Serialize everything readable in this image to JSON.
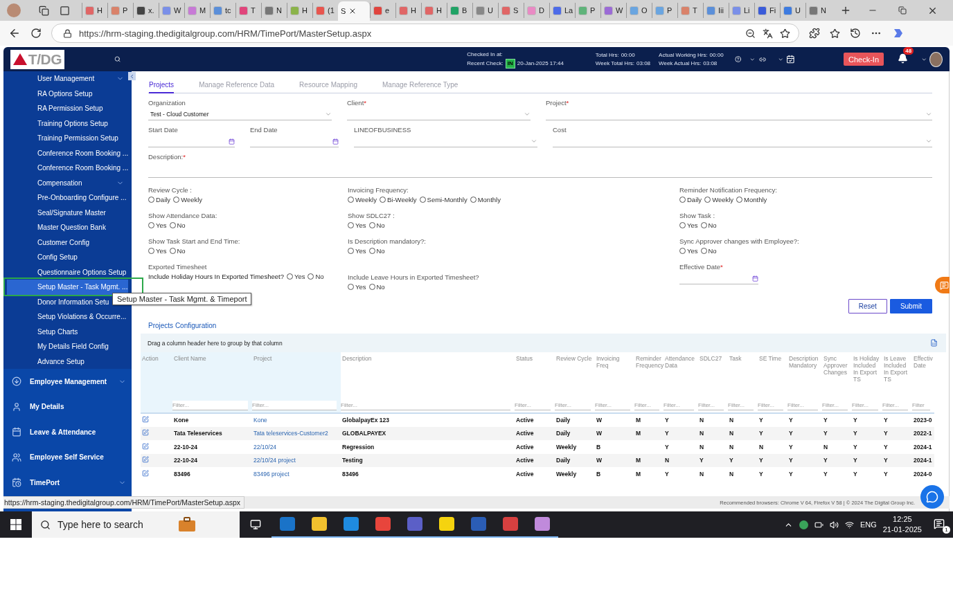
{
  "browser": {
    "tabs": [
      {
        "title": "H",
        "color": "#e06666",
        "selected": false
      },
      {
        "title": "P",
        "color": "#d9826a",
        "selected": false
      },
      {
        "title": "x.",
        "color": "#444444",
        "selected": false
      },
      {
        "title": "W",
        "color": "#7a8fe8",
        "selected": false
      },
      {
        "title": "M",
        "color": "#c77ad6",
        "selected": false
      },
      {
        "title": "tc",
        "color": "#5b8fd9",
        "selected": false
      },
      {
        "title": "T",
        "color": "#e0457b",
        "selected": false
      },
      {
        "title": "N",
        "color": "#777777",
        "selected": false
      },
      {
        "title": "H",
        "color": "#8bb34a",
        "selected": false
      },
      {
        "title": "(1",
        "color": "#e8554e",
        "selected": false
      },
      {
        "title": "S",
        "selected": true
      },
      {
        "title": "e",
        "color": "#e0443e",
        "selected": false
      },
      {
        "title": "H",
        "color": "#e06666",
        "selected": false
      },
      {
        "title": "H",
        "color": "#e06666",
        "selected": false
      },
      {
        "title": "B",
        "color": "#21a366",
        "selected": false
      },
      {
        "title": "U",
        "color": "#888888",
        "selected": false
      },
      {
        "title": "S",
        "color": "#e06666",
        "selected": false
      },
      {
        "title": "D",
        "color": "#e98ac4",
        "selected": false
      },
      {
        "title": "La",
        "color": "#4d6be8",
        "selected": false
      },
      {
        "title": "P",
        "color": "#5fb37a",
        "selected": false
      },
      {
        "title": "W",
        "color": "#9b6bd6",
        "selected": false
      },
      {
        "title": "O",
        "color": "#6aa5e0",
        "selected": false
      },
      {
        "title": "P",
        "color": "#6aa5e0",
        "selected": false
      },
      {
        "title": "T",
        "color": "#d9826a",
        "selected": false
      },
      {
        "title": "Iii",
        "color": "#5b8fd9",
        "selected": false
      },
      {
        "title": "Li",
        "color": "#7a8fe8",
        "selected": false
      },
      {
        "title": "Fi",
        "color": "#3a5bd9",
        "selected": false
      },
      {
        "title": "U",
        "color": "#3d7be0",
        "selected": false
      },
      {
        "title": "N",
        "color": "#777777",
        "selected": false
      }
    ],
    "url": "https://hrm-staging.thedigitalgroup.com/HRM/TimePort/MasterSetup.aspx"
  },
  "header": {
    "logo": "T/DG",
    "checked_in_label": "Checked In at:",
    "recent_check_label": "Recent Check:",
    "status_badge": "IN",
    "recent_check_time": "20-Jan-2025 17:44",
    "stats": [
      {
        "label": "Total Hrs:",
        "value": "00:00"
      },
      {
        "label": "Week Total Hrs:",
        "value": "03:08"
      },
      {
        "label": "Actual Working Hrs:",
        "value": "00:00"
      },
      {
        "label": "Week Actual Hrs:",
        "value": "03:08"
      }
    ],
    "check_in_button": "Check-In",
    "notification_count": "48"
  },
  "sidebar": {
    "sub_items": [
      {
        "label": "User Management",
        "expandable": true,
        "selected": false
      },
      {
        "label": "RA Options Setup",
        "selected": false
      },
      {
        "label": "RA Permission Setup",
        "selected": false
      },
      {
        "label": "Training Options Setup",
        "selected": false
      },
      {
        "label": "Training Permission Setup",
        "selected": false
      },
      {
        "label": "Conference Room Booking ...",
        "selected": false
      },
      {
        "label": "Conference Room Booking ...",
        "selected": false
      },
      {
        "label": "Compensation",
        "expandable": true,
        "selected": false
      },
      {
        "label": "Pre-Onboarding Configure ...",
        "selected": false
      },
      {
        "label": "Seal/Signature Master",
        "selected": false
      },
      {
        "label": "Master Question Bank",
        "selected": false
      },
      {
        "label": "Customer Config",
        "selected": false
      },
      {
        "label": "Config Setup",
        "selected": false
      },
      {
        "label": "Questionnaire Options Setup",
        "selected": false
      },
      {
        "label": "Setup Master - Task Mgmt. ...",
        "selected": true
      },
      {
        "label": "Donor Information Setu",
        "selected": false
      },
      {
        "label": "Setup Violations & Occurre...",
        "selected": false
      },
      {
        "label": "Setup Charts",
        "selected": false
      },
      {
        "label": "My Details Field Config",
        "selected": false
      },
      {
        "label": "Advance Setup",
        "selected": false
      }
    ],
    "tooltip": "Setup Master - Task Mgmt. & Timeport",
    "sections": [
      {
        "label": "Employee Management",
        "kind": "download",
        "expandable": true
      },
      {
        "label": "My Details",
        "kind": "person",
        "expandable": false
      },
      {
        "label": "Leave & Attendance",
        "kind": "calendar",
        "expandable": false
      },
      {
        "label": "Employee Self Service",
        "kind": "people",
        "expandable": false
      },
      {
        "label": "TimePort",
        "kind": "calendar-clock",
        "expandable": true
      }
    ]
  },
  "tabs": [
    {
      "label": "Projects",
      "selected": true
    },
    {
      "label": "Manage Reference Data",
      "selected": false
    },
    {
      "label": "Resource Mapping",
      "selected": false
    },
    {
      "label": "Manage Reference Type",
      "selected": false
    }
  ],
  "field_rows": [
    [
      {
        "label": "Organization",
        "kind": "select",
        "value": "Test - Cloud Customer"
      },
      {
        "label": "Client",
        "required_mark": "*",
        "kind": "select"
      },
      {
        "label": "Project",
        "required_mark": "*",
        "kind": "select"
      }
    ],
    [
      {
        "label": "Start Date",
        "kind": "date"
      },
      {
        "label": "End Date",
        "kind": "date"
      },
      {
        "label": "LINEOFBUSINESS",
        "kind": "select"
      },
      {
        "label": "Cost",
        "kind": "select"
      }
    ],
    [
      {
        "label": "Description:",
        "required_mark": "*",
        "kind": "text"
      }
    ]
  ],
  "option_rows": [
    [
      {
        "kind": "radio",
        "label": "Review Cycle :",
        "options": [
          {
            "label": "Daily",
            "checked": false
          },
          {
            "label": "Weekly",
            "checked": false
          }
        ]
      },
      {
        "kind": "radio",
        "label": "Invoicing Frequency:",
        "options": [
          {
            "label": "Weekly",
            "checked": false
          },
          {
            "label": "Bi-Weekly",
            "checked": false
          },
          {
            "label": "Semi-Monthly",
            "checked": false
          },
          {
            "label": "Monthly",
            "checked": false
          }
        ]
      },
      {
        "kind": "radio",
        "label": "Reminder Notification Frequency:",
        "options": [
          {
            "label": "Daily",
            "checked": false
          },
          {
            "label": "Weekly",
            "checked": false
          },
          {
            "label": "Monthly",
            "checked": false
          }
        ]
      }
    ],
    [
      {
        "kind": "radio",
        "label": "Show Attendance Data:",
        "options": [
          {
            "label": "Yes",
            "checked": false
          },
          {
            "label": "No",
            "checked": false
          }
        ]
      },
      {
        "kind": "radio",
        "label": "Show SDLC27 :",
        "options": [
          {
            "label": "Yes",
            "checked": false
          },
          {
            "label": "No",
            "checked": false
          }
        ]
      },
      {
        "kind": "radio",
        "label": "Show Task :",
        "options": [
          {
            "label": "Yes",
            "checked": false
          },
          {
            "label": "No",
            "checked": false
          }
        ]
      }
    ],
    [
      {
        "kind": "radio",
        "label": "Show Task Start and End Time:",
        "options": [
          {
            "label": "Yes",
            "checked": false
          },
          {
            "label": "No",
            "checked": false
          }
        ]
      },
      {
        "kind": "radio",
        "label": "Is Description mandatory?:",
        "options": [
          {
            "label": "Yes",
            "checked": false
          },
          {
            "label": "No",
            "checked": false
          }
        ]
      },
      {
        "kind": "radio",
        "label": "Sync Approver changes with Employee?:",
        "options": [
          {
            "label": "Yes",
            "checked": false
          },
          {
            "label": "No",
            "checked": false
          }
        ]
      }
    ],
    [
      {
        "kind": "inline_radio",
        "heading": "Exported Timesheet",
        "label": "Include Holiday Hours In Exported Timesheet?",
        "options": [
          {
            "label": "Yes",
            "checked": false
          },
          {
            "label": "No",
            "checked": false
          }
        ]
      },
      {
        "kind": "radio",
        "label": "Include Leave Hours in Exported Timesheet?",
        "options": [
          {
            "label": "Yes",
            "checked": false
          },
          {
            "label": "No",
            "checked": false
          }
        ]
      },
      {
        "kind": "date",
        "label": "Effective Date",
        "required_mark": "*"
      }
    ]
  ],
  "buttons": [
    {
      "label": "Reset",
      "kind": "secondary"
    },
    {
      "label": "Submit",
      "kind": "primary"
    }
  ],
  "grid": {
    "title": "Projects Configuration",
    "group_hint": "Drag a column header here to group by that column",
    "columns": [
      {
        "header": "Action",
        "kind": "action",
        "frozen": true
      },
      {
        "header": "Client Name",
        "placeholder": "Filter...",
        "kind": "text",
        "frozen": true
      },
      {
        "header": "Project",
        "placeholder": "Filter...",
        "kind": "link",
        "frozen": true
      },
      {
        "header": "Description",
        "placeholder": "Filter...",
        "kind": "text",
        "frozen": false
      },
      {
        "header": "Status",
        "placeholder": "Filter...",
        "kind": "text",
        "frozen": false
      },
      {
        "header": "Review Cycle",
        "placeholder": "Filter...",
        "kind": "text",
        "frozen": false
      },
      {
        "header": "Invoicing Freq",
        "placeholder": "Filter...",
        "kind": "text",
        "frozen": false
      },
      {
        "header": "Reminder Frequency",
        "placeholder": "Filter...",
        "kind": "text",
        "frozen": false
      },
      {
        "header": "Attendance Data",
        "placeholder": "Filter...",
        "kind": "text",
        "frozen": false
      },
      {
        "header": "SDLC27",
        "placeholder": "Filter...",
        "kind": "text",
        "frozen": false
      },
      {
        "header": "Task",
        "placeholder": "Filter...",
        "kind": "text",
        "frozen": false
      },
      {
        "header": "SE Time",
        "placeholder": "Filter...",
        "kind": "text",
        "frozen": false
      },
      {
        "header": "Description Mandatory",
        "placeholder": "Filter...",
        "kind": "text",
        "frozen": false
      },
      {
        "header": "Sync Approver Changes",
        "placeholder": "Filter...",
        "kind": "text",
        "frozen": false
      },
      {
        "header": "Is Holiday Included In Export TS",
        "placeholder": "Filter...",
        "kind": "text",
        "frozen": false
      },
      {
        "header": "Is Leave Included In Export TS",
        "placeholder": "Filter...",
        "kind": "text",
        "frozen": false
      },
      {
        "header": "Effectiv Date",
        "placeholder": "Filter",
        "kind": "text",
        "frozen": false
      }
    ],
    "rows": [
      [
        null,
        "Kone",
        "Kone",
        "GlobalpayEx 123",
        "Active",
        "Daily",
        "W",
        "M",
        "Y",
        "N",
        "N",
        "Y",
        "Y",
        "Y",
        "Y",
        "Y",
        "2023-0"
      ],
      [
        null,
        "Tata Teleservices",
        "Tata teleservices-Customer2",
        "GLOBALPAYEX",
        "Active",
        "Daily",
        "W",
        "M",
        "Y",
        "N",
        "N",
        "Y",
        "Y",
        "Y",
        "Y",
        "Y",
        "2022-1"
      ],
      [
        null,
        "22-10-24",
        "22/10/24",
        "Regression",
        "Active",
        "Weekly",
        "B",
        null,
        "Y",
        "N",
        "N",
        "N",
        "Y",
        "N",
        "Y",
        "Y",
        "2024-1"
      ],
      [
        null,
        "22-10-24",
        "22/10/24 project",
        "Testing",
        "Active",
        "Daily",
        "W",
        "M",
        "N",
        "Y",
        "Y",
        "Y",
        "Y",
        "Y",
        "Y",
        "Y",
        "2024-1"
      ],
      [
        null,
        "83496",
        "83496 project",
        "83496",
        "Active",
        "Weekly",
        "B",
        "M",
        "Y",
        "N",
        "N",
        "Y",
        "Y",
        "Y",
        "Y",
        "Y",
        "2024-0"
      ]
    ]
  },
  "footer": {
    "status_url": "https://hrm-staging.thedigitalgroup.com/HRM/TimePort/MasterSetup.aspx",
    "text": "Recommended browsers: Chrome V 64, Firefox V 58  |  © 2024 The Digital Group Inc."
  },
  "taskbar": {
    "search_placeholder": "Type here to search",
    "language": "ENG",
    "time": "12:25",
    "date": "21-01-2025",
    "notifications": "1"
  }
}
